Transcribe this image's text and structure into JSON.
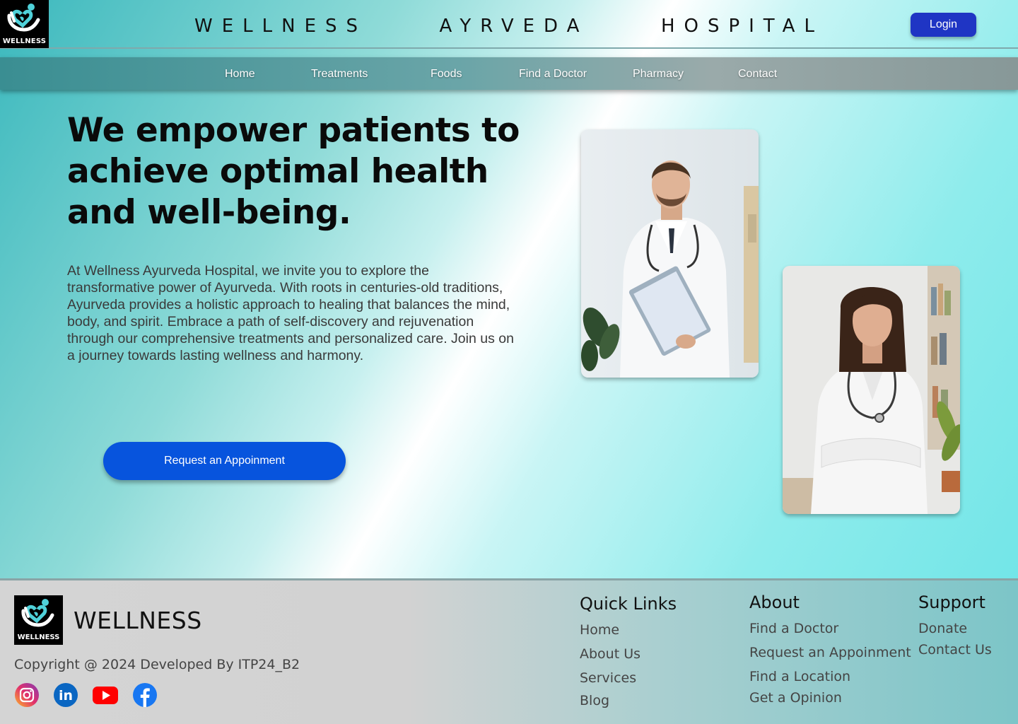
{
  "header": {
    "logo_text": "WELLNESS",
    "site_title": "WELLNESS  AYRVEDA  HOSPITAL",
    "login_label": "Login"
  },
  "nav": {
    "items": [
      {
        "label": "Home"
      },
      {
        "label": "Treatments"
      },
      {
        "label": "Foods"
      },
      {
        "label": "Find a Doctor"
      },
      {
        "label": "Pharmacy"
      },
      {
        "label": "Contact"
      }
    ]
  },
  "hero": {
    "title": "We empower patients to achieve optimal health and well-being.",
    "description": "At Wellness Ayurveda Hospital, we invite you to explore the transformative power of Ayurveda. With roots in centuries-old traditions, Ayurveda provides a holistic approach to healing that balances the mind, body, and spirit. Embrace a path of self-discovery and rejuvenation through our comprehensive treatments and personalized care. Join us on a journey towards lasting wellness and harmony.",
    "cta_label": "Request an Appoinment"
  },
  "footer": {
    "logo_text": "WELLNESS",
    "brand": "WELLNESS",
    "copyright": "Copyright @ 2024 Developed By ITP24_B2",
    "social_icons": [
      "instagram-icon",
      "linkedin-icon",
      "youtube-icon",
      "facebook-icon"
    ],
    "quick_links": {
      "heading": "Quick Links",
      "items": [
        "Home",
        "About Us",
        "Services",
        "Blog"
      ]
    },
    "about": {
      "heading": "About",
      "items": [
        "Find a Doctor",
        "Request an Appoinment",
        "Find a Location",
        "Get a Opinion"
      ]
    },
    "support": {
      "heading": "Support",
      "items": [
        "Donate",
        "Contact Us"
      ]
    }
  },
  "colors": {
    "login_button": "#1f35c4",
    "cta_button": "#0754dd",
    "logo_accent": "#4fd1d9"
  }
}
